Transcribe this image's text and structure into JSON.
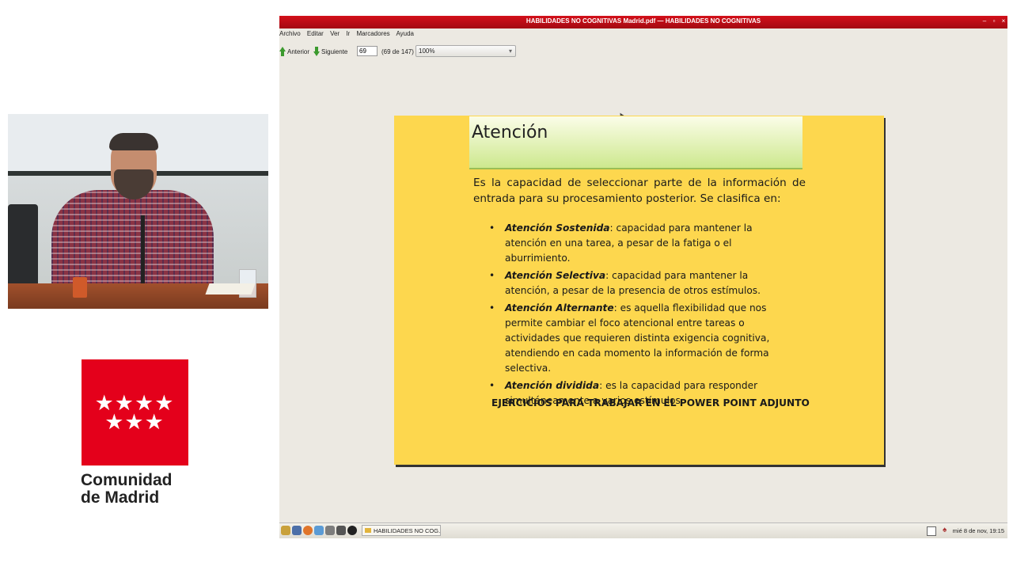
{
  "logo": {
    "stars": "★★★★ ★★★",
    "line1": "Comunidad",
    "line2": "de Madrid",
    "color": "#e4001b"
  },
  "window": {
    "title": "HABILIDADES NO COGNITIVAS Madrid.pdf — HABILIDADES NO COGNITIVAS",
    "title_color": "#c00e18",
    "controls": [
      "minimize-icon",
      "maximize-icon",
      "close-icon"
    ]
  },
  "menu": {
    "items": [
      "Archivo",
      "Editar",
      "Ver",
      "Ir",
      "Marcadores",
      "Ayuda"
    ]
  },
  "toolbar": {
    "prev_label": "Anterior",
    "next_label": "Siguiente",
    "page_value": "69",
    "page_count": "(69 de 147)",
    "zoom_value": "100%"
  },
  "slide": {
    "title": "Atención",
    "intro": "Es la capacidad de seleccionar parte de la información de entrada para su procesamiento posterior. Se clasifica en:",
    "items": [
      {
        "term": "Atención Sostenida",
        "text": ": capacidad para mantener la atención en una tarea, a pesar de la fatiga o el aburrimiento."
      },
      {
        "term": "Atención Selectiva",
        "text": ": capacidad para mantener la atención, a pesar de la presencia de otros estímulos."
      },
      {
        "term": "Atención Alternante",
        "text": ": es aquella flexibilidad que nos permite cambiar el foco atencional entre tareas o actividades que requieren distinta exigencia cognitiva, atendiendo en cada momento la información de forma selectiva."
      },
      {
        "term": "Atención dividida",
        "text": ": es la capacidad para responder simultáneamente a varios estímulos."
      }
    ],
    "footer": "EJERCICIOS PARA TRABAJAR EN EL POWER POINT ADJUNTO",
    "background": "#fdd74e"
  },
  "taskbar": {
    "task_label": "HABILIDADES NO COG...",
    "clock": "mié 8 de nov, 19:15"
  }
}
